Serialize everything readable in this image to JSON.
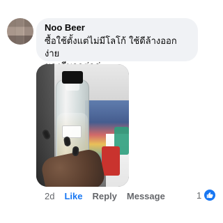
{
  "comment": {
    "author": "Noo Beer",
    "text_line1": "ซื้อใช้ตั้งแต่ไม่มีโลโก้ ใช้ดีล้างออกง่าย",
    "text_line2": "ของดีบอกต่อค่ะ"
  },
  "actions": {
    "time": "2d",
    "like": "Like",
    "reply": "Reply",
    "message": "Message"
  },
  "reactions": {
    "count": "1",
    "icon": "like-icon"
  },
  "colors": {
    "accent": "#1877f2",
    "muted": "#65676b",
    "bubble": "#f0f2f5"
  }
}
